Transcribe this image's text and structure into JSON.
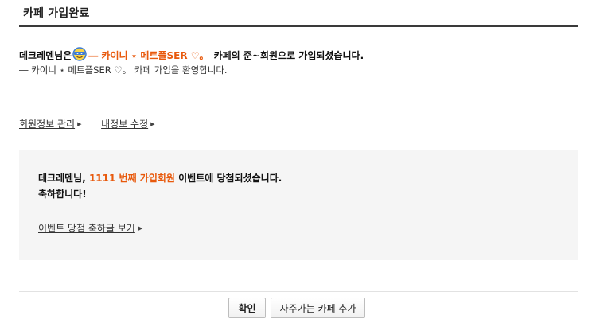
{
  "header": {
    "title": "카페 가입완료"
  },
  "welcome": {
    "user": "데크레멘님은",
    "emoticon_icon": "smiley-badge-icon",
    "nickname": "― 카이니 ⋆ 메트플SER ♡。",
    "suffix": "카페의 준~회원으로 가입되셨습니다.",
    "line2": "― 카이니 ⋆ 메트플SER ♡。 카페 가입을 환영합니다."
  },
  "links": {
    "member_info": "회원정보 관리",
    "my_info": "내정보 수정"
  },
  "event": {
    "prefix": "데크레멘님,",
    "highlight": "1111 번째 가입회원",
    "suffix": "이벤트에 당첨되셨습니다.",
    "line2": "축하합니다!",
    "link": "이벤트 당첨 축하글 보기"
  },
  "buttons": {
    "ok": "확인",
    "add_favorite": "자주가는 카페 추가"
  },
  "colors": {
    "accent": "#e8590c",
    "rule": "#3a3a3a",
    "box_bg": "#f5f5f5"
  }
}
